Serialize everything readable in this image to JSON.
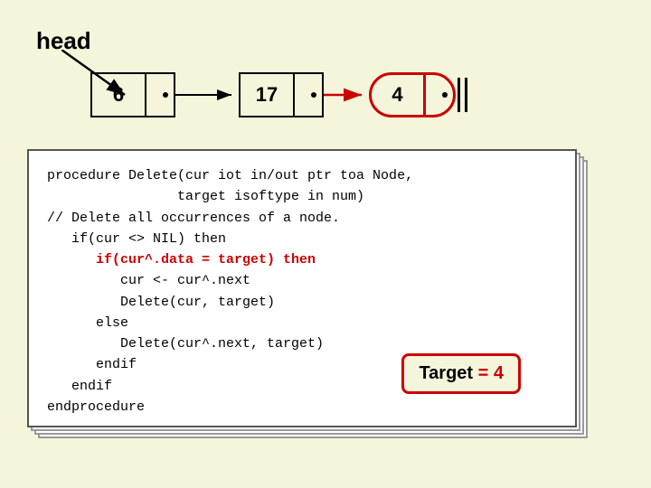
{
  "header": {
    "head_label": "head"
  },
  "linked_list": {
    "nodes": [
      {
        "value": "6",
        "highlighted": false
      },
      {
        "value": "17",
        "highlighted": false
      },
      {
        "value": "4",
        "highlighted": true
      }
    ]
  },
  "code": {
    "lines": [
      {
        "text": "procedure Delete(cur iot in/out ptr toa Node,",
        "style": "normal"
      },
      {
        "text": "                target isoftype in num)",
        "style": "normal"
      },
      {
        "text": "// Delete all occurrences of a node.",
        "style": "normal"
      },
      {
        "text": "   if(cur <> NIL) then",
        "style": "normal"
      },
      {
        "text": "      if(cur^.data = target) then",
        "style": "red"
      },
      {
        "text": "         cur <- cur^.next",
        "style": "normal"
      },
      {
        "text": "         Delete(cur, target)",
        "style": "normal"
      },
      {
        "text": "      else",
        "style": "normal"
      },
      {
        "text": "         Delete(cur^.next, target)",
        "style": "normal"
      },
      {
        "text": "      endif",
        "style": "normal"
      },
      {
        "text": "   endif",
        "style": "normal"
      },
      {
        "text": "endprocedure",
        "style": "normal"
      }
    ]
  },
  "target_badge": {
    "label": "Target = 4"
  }
}
